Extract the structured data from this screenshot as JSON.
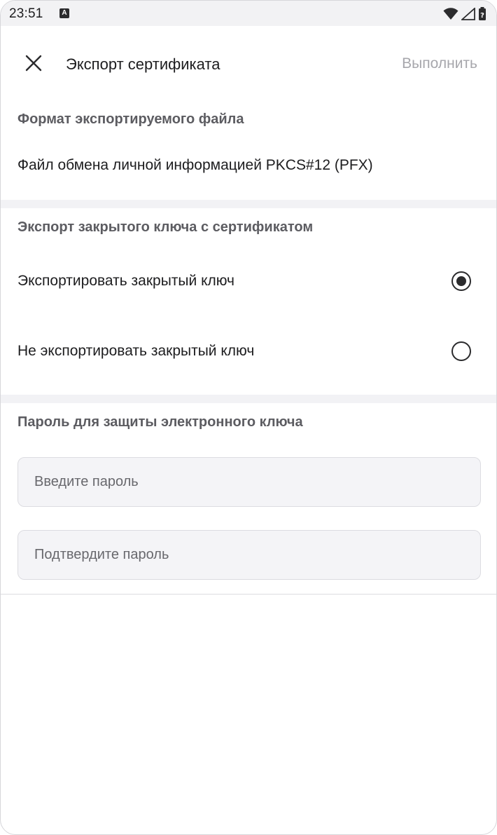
{
  "status_bar": {
    "time": "23:51",
    "notification_icon": "a-icon",
    "icons": [
      "wifi-icon",
      "signal-icon",
      "battery-icon"
    ]
  },
  "app_bar": {
    "close_icon": "close-icon",
    "title": "Экспорт сертификата",
    "action_label": "Выполнить"
  },
  "format_section": {
    "label": "Формат экспортируемого файла",
    "value": "Файл обмена личной информацией PKCS#12 (PFX)"
  },
  "private_key_section": {
    "label": "Экспорт закрытого ключа с сертификатом",
    "options": [
      {
        "label": "Экспортировать закрытый ключ",
        "selected": true
      },
      {
        "label": "Не экспортировать закрытый ключ",
        "selected": false
      }
    ]
  },
  "password_section": {
    "label": "Пароль для защиты электронного ключа",
    "password_field": {
      "placeholder": "Введите пароль",
      "value": ""
    },
    "confirm_field": {
      "placeholder": "Подтвердите пароль",
      "value": ""
    }
  },
  "colors": {
    "text_primary": "#1d1d1f",
    "text_secondary": "#5c5c61",
    "action_disabled": "#a7a7ac",
    "divider": "#f2f2f5"
  }
}
